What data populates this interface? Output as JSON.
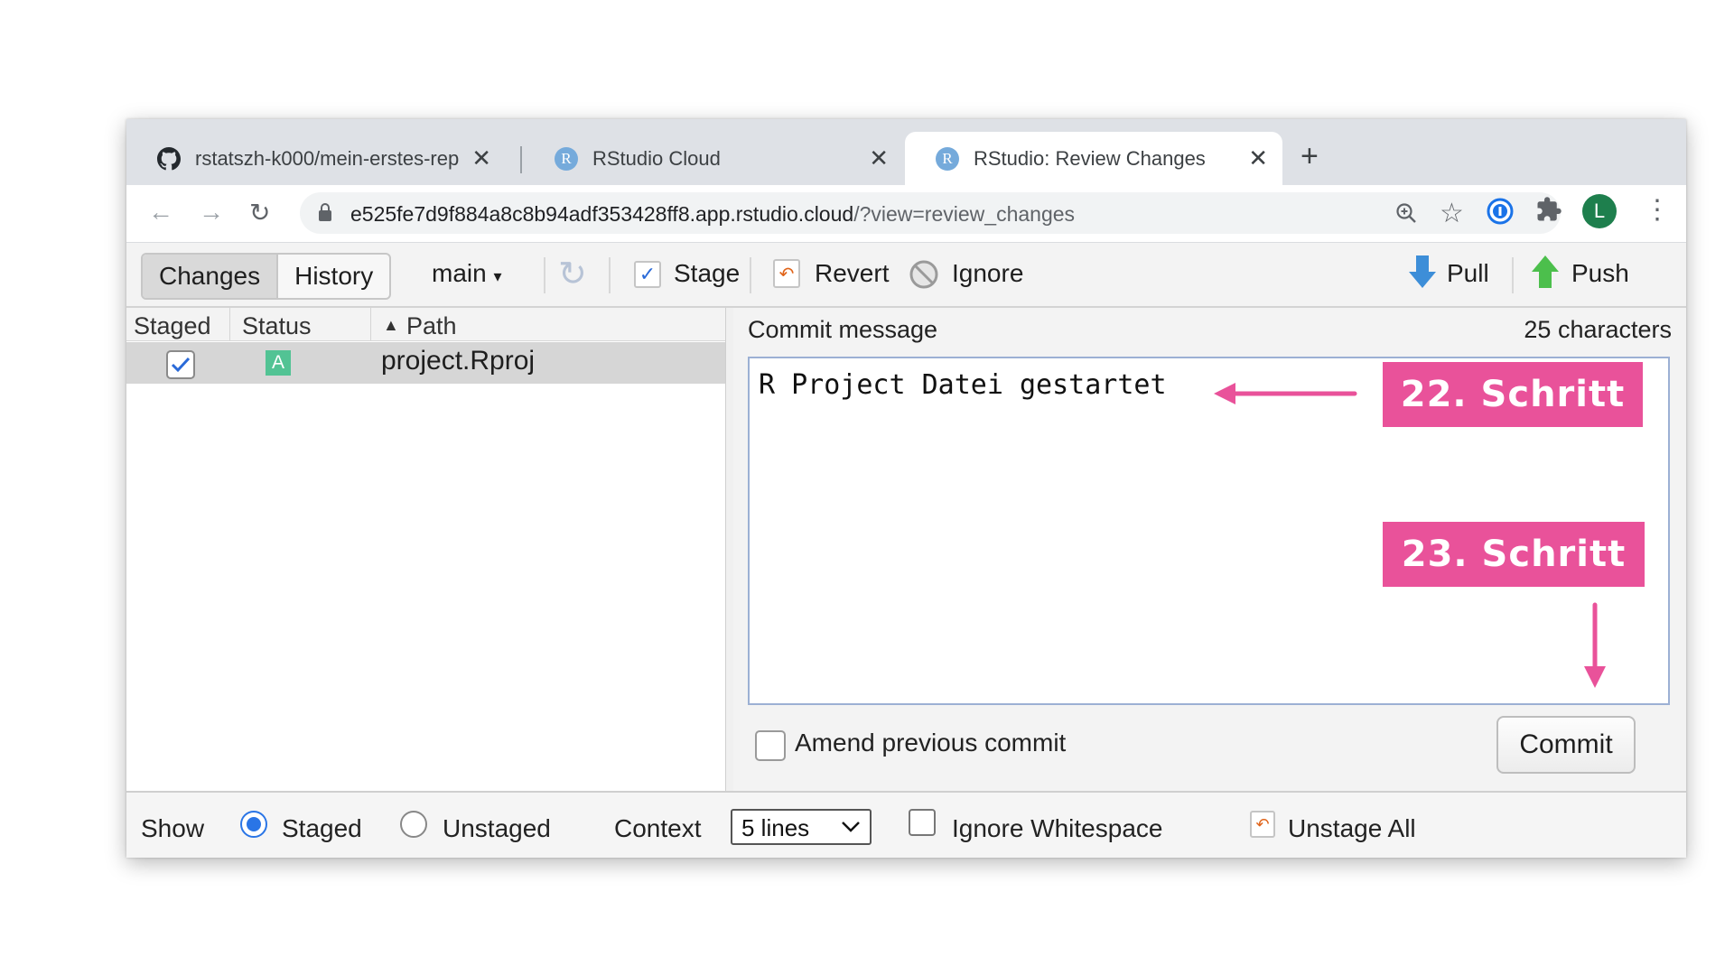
{
  "browser": {
    "tabs": [
      {
        "title": "rstatszh-k000/mein-erstes-rep",
        "icon": "github-icon",
        "active": false
      },
      {
        "title": "RStudio Cloud",
        "icon": "rstudio-icon",
        "active": false
      },
      {
        "title": "RStudio: Review Changes",
        "icon": "rstudio-icon",
        "active": true
      }
    ],
    "url_host": "e525fe7d9f884a8c8b94adf353428ff8.app.rstudio.cloud",
    "url_path": "/?view=review_changes",
    "profile_initial": "L"
  },
  "toolbar": {
    "changes": "Changes",
    "history": "History",
    "branch": "main",
    "stage": "Stage",
    "revert": "Revert",
    "ignore": "Ignore",
    "pull": "Pull",
    "push": "Push"
  },
  "files": {
    "headers": {
      "staged": "Staged",
      "status": "Status",
      "path": "Path"
    },
    "rows": [
      {
        "staged": true,
        "status": "A",
        "path": "project.Rproj"
      }
    ]
  },
  "commit": {
    "label": "Commit message",
    "count": "25 characters",
    "message": "R Project Datei gestartet",
    "amend_label": "Amend previous commit",
    "commit_button": "Commit"
  },
  "bottom": {
    "show": "Show",
    "staged": "Staged",
    "unstaged": "Unstaged",
    "context": "Context",
    "context_value": "5 lines",
    "ignore_ws": "Ignore Whitespace",
    "unstage_all": "Unstage All"
  },
  "annotations": {
    "step22": "22. Schritt",
    "step23": "23. Schritt",
    "color": "#e9529a"
  }
}
